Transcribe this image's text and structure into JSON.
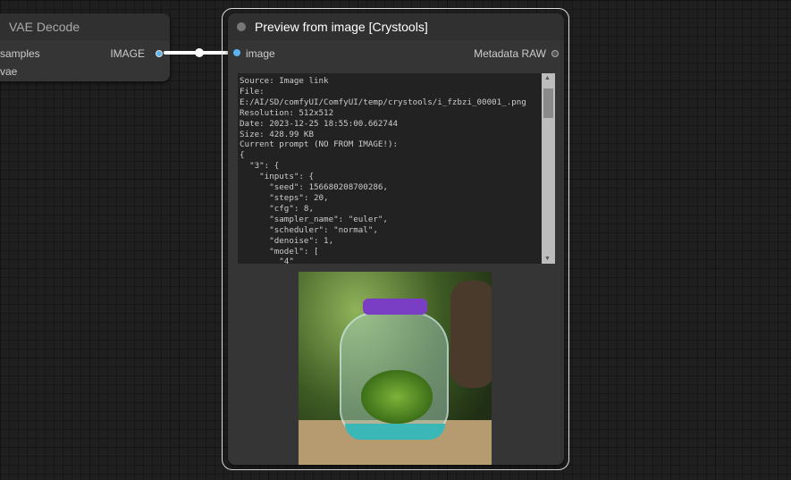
{
  "vae_node": {
    "title": "VAE Decode",
    "inputs": [
      "samples",
      "vae"
    ],
    "output": "IMAGE"
  },
  "preview_node": {
    "title": "Preview from image [Crystools]",
    "input": "image",
    "output": "Metadata RAW",
    "metadata_text": "Source: Image link\nFile:\nE:/AI/SD/comfyUI/ComfyUI/temp/crystools/i_fzbzi_00001_.png\nResolution: 512x512\nDate: 2023-12-25 18:55:00.662744\nSize: 428.99 KB\nCurrent prompt (NO FROM IMAGE!):\n{\n  \"3\": {\n    \"inputs\": {\n      \"seed\": 156680208700286,\n      \"steps\": 20,\n      \"cfg\": 8,\n      \"sampler_name\": \"euler\",\n      \"scheduler\": \"normal\",\n      \"denoise\": 1,\n      \"model\": [\n        \"4\""
  },
  "colors": {
    "image_slot": "#5ab4f0",
    "metadata_slot": "#8888aa"
  }
}
